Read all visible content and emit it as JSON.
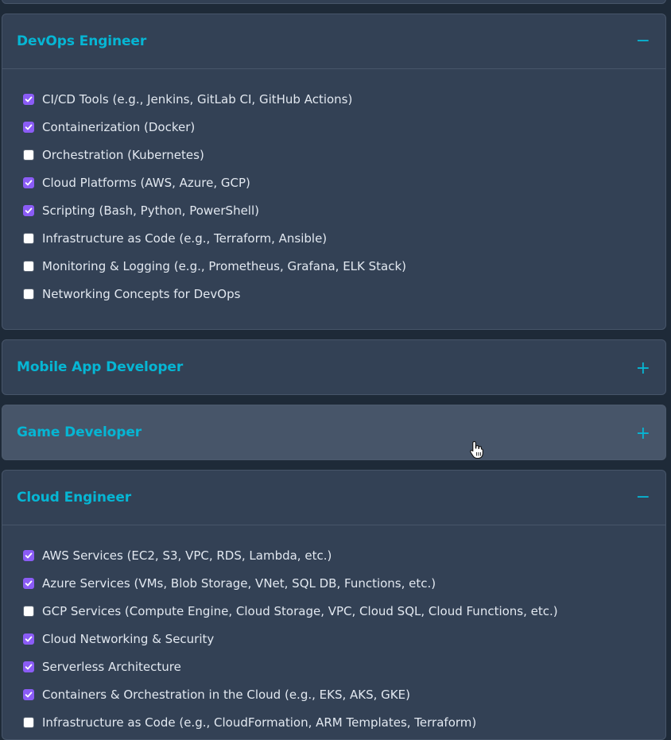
{
  "colors": {
    "accent": "#06b6d4",
    "check": "#8b5cf6",
    "panel_bg": "#334155",
    "panel_hover_bg": "#475569",
    "text": "#e2e8f0"
  },
  "sections": [
    {
      "title": "DevOps Engineer",
      "toggle": "−",
      "expanded": true,
      "items": [
        {
          "label": "CI/CD Tools (e.g., Jenkins, GitLab CI, GitHub Actions)",
          "checked": true
        },
        {
          "label": "Containerization (Docker)",
          "checked": true
        },
        {
          "label": "Orchestration (Kubernetes)",
          "checked": false
        },
        {
          "label": "Cloud Platforms (AWS, Azure, GCP)",
          "checked": true
        },
        {
          "label": "Scripting (Bash, Python, PowerShell)",
          "checked": true
        },
        {
          "label": "Infrastructure as Code (e.g., Terraform, Ansible)",
          "checked": false
        },
        {
          "label": "Monitoring & Logging (e.g., Prometheus, Grafana, ELK Stack)",
          "checked": false
        },
        {
          "label": "Networking Concepts for DevOps",
          "checked": false
        }
      ]
    },
    {
      "title": "Mobile App Developer",
      "toggle": "+",
      "expanded": false,
      "items": []
    },
    {
      "title": "Game Developer",
      "toggle": "+",
      "expanded": false,
      "hovered": true,
      "items": []
    },
    {
      "title": "Cloud Engineer",
      "toggle": "−",
      "expanded": true,
      "items": [
        {
          "label": "AWS Services (EC2, S3, VPC, RDS, Lambda, etc.)",
          "checked": true
        },
        {
          "label": "Azure Services (VMs, Blob Storage, VNet, SQL DB, Functions, etc.)",
          "checked": true
        },
        {
          "label": "GCP Services (Compute Engine, Cloud Storage, VPC, Cloud SQL, Cloud Functions, etc.)",
          "checked": false
        },
        {
          "label": "Cloud Networking & Security",
          "checked": true
        },
        {
          "label": "Serverless Architecture",
          "checked": true
        },
        {
          "label": "Containers & Orchestration in the Cloud (e.g., EKS, AKS, GKE)",
          "checked": true
        },
        {
          "label": "Infrastructure as Code (e.g., CloudFormation, ARM Templates, Terraform)",
          "checked": false
        }
      ]
    }
  ],
  "cursor": {
    "icon": "hand-pointer-icon"
  }
}
